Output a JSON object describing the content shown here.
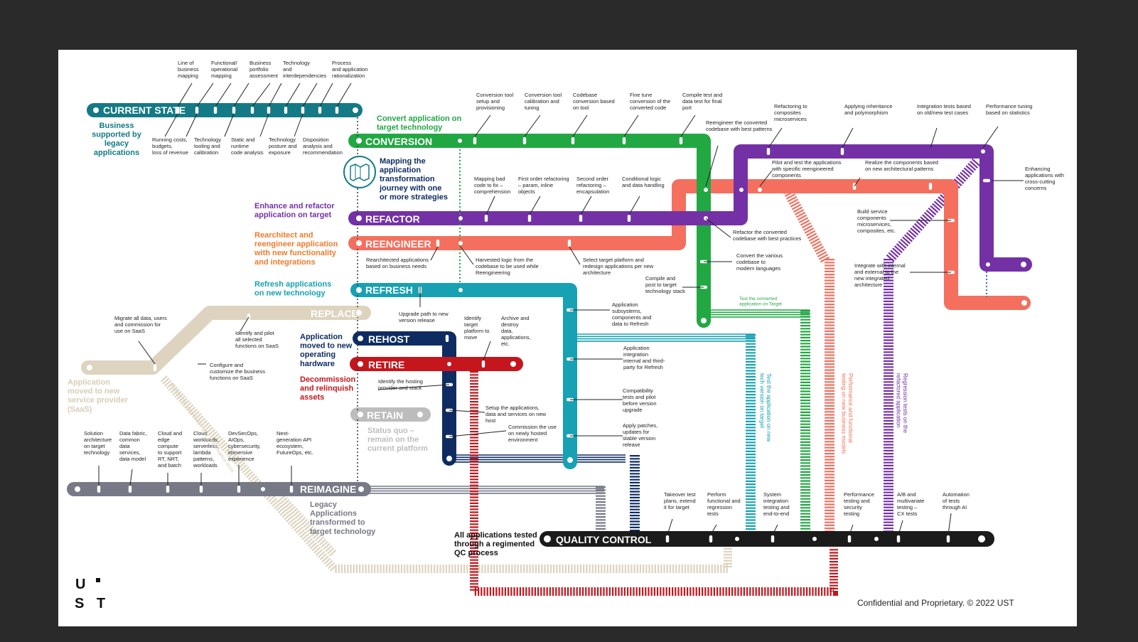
{
  "colors": {
    "page": "#2a2a2a",
    "slide": "#ffffff",
    "current": "#137a86",
    "conversion": "#22a843",
    "refactor": "#7431a6",
    "reengineer": "#f46f5e",
    "refresh": "#17a1b3",
    "replace": "#ddd3bf",
    "rehost": "#0f2c62",
    "retire": "#c4161c",
    "retain": "#bdbdbd",
    "reimagine": "#777a86",
    "qc": "#1b1b1b"
  },
  "lines": {
    "current": "CURRENT STATE",
    "conversion": "CONVERSION",
    "refactor": "REFACTOR",
    "reengineer": "REENGINEER",
    "refresh": "REFRESH",
    "replace": "REPLACE",
    "rehost": "REHOST",
    "retire": "RETIRE",
    "retain": "RETAIN",
    "reimagine": "REIMAGINE",
    "qc": "QUALITY CONTROL"
  },
  "headings": {
    "business": [
      "Business",
      "supported by",
      "legacy",
      "applications"
    ],
    "mapping": [
      "Mapping the",
      "application",
      "transformation",
      "journey with one",
      "or more strategies"
    ],
    "convert": [
      "Convert application on",
      "target technology"
    ],
    "enhance": [
      "Enhance  and refactor",
      "application on target"
    ],
    "rearchitect": [
      "Rearchitect and",
      "reengineer application",
      "with new functionality",
      "and integrations"
    ],
    "refresh": [
      "Refresh applications",
      "on new technology"
    ],
    "saas": [
      "Application",
      "moved to new",
      "service provider",
      "(SaaS)"
    ],
    "rehost": [
      "Application",
      "moved to new",
      "operating",
      "hardware"
    ],
    "retire": [
      "Decommission",
      "and relinquish",
      "assets"
    ],
    "retain": [
      "Status quo –",
      "remain on the",
      "current platform"
    ],
    "legacy": [
      "Legacy",
      "Applications",
      "transformed to",
      "target technology"
    ],
    "qc": [
      "All applications tested",
      "through a regimented",
      "QC process"
    ]
  },
  "current_top": [
    [
      "Line of",
      "business",
      "mapping"
    ],
    [
      "Functional/",
      "operational",
      "mapping"
    ],
    [
      "Business",
      "portfolio",
      "assessment"
    ],
    [
      "Technology",
      "and",
      "interdependencies"
    ],
    [
      "Process",
      "and application",
      "rationalization"
    ]
  ],
  "current_bottom": [
    [
      "Running costs,",
      "budgets,",
      "loss of revenue"
    ],
    [
      "Technology",
      "tooling and",
      "calibration"
    ],
    [
      "Static and",
      "runtime",
      "code analysis"
    ],
    [
      "Technology",
      "posture and",
      "exposure"
    ],
    [
      "Disposition",
      "analysis and",
      "recommendation"
    ]
  ],
  "conversion_top": [
    [
      "Conversion tool",
      "setup and",
      "provisioning"
    ],
    [
      "Conversion tool",
      "calibration and",
      "tuning"
    ],
    [
      "Codebase",
      "conversion based",
      "on tool"
    ],
    [
      "Fine tune",
      "conversion of the",
      "converted code"
    ],
    [
      "Compile test and",
      "data test for final",
      "port"
    ]
  ],
  "refactor_top": [
    [
      "Mapping bad",
      "code to fix –",
      "comprehension"
    ],
    [
      "First order refactoring",
      "– param, inline",
      "objects"
    ],
    [
      "Second order",
      "refactoring –",
      "encapsulation"
    ],
    [
      "Conditional logic",
      "and data handling"
    ]
  ],
  "purple_top": [
    [
      "Refactoring to",
      "composites",
      "microservices"
    ],
    [
      "Applying inheritance",
      "and polymorphism"
    ],
    [
      "Integration tests based",
      "on old/new test cases"
    ],
    [
      "Performance tuning",
      "based on statistics"
    ]
  ],
  "mid_labels": {
    "reengineer_best": [
      "Reengineer the converted",
      "codebase with best patterns"
    ],
    "pilot": [
      "Pilot and test the applications",
      "with specific reengineered",
      "components"
    ],
    "realize": [
      "Realize the components based",
      "on new architectural patterns"
    ],
    "enhancing": [
      "Enhancing",
      "applications with",
      "cross-cutting",
      "concerns"
    ],
    "build": [
      "Build service",
      "components",
      "microservices,",
      "composites, etc."
    ],
    "integrate": [
      "Integrate with internal",
      "and external to the",
      "new integrated",
      "architecture"
    ],
    "refactor_best": [
      "Refactor the converted",
      "codebase with best practices"
    ],
    "convert_lang": [
      "Convert the various",
      "codebase to",
      "modern languages"
    ],
    "compile": [
      "Compile and",
      "post to target",
      "technology stack"
    ],
    "test_target": [
      "Test the converted",
      "application on Target"
    ],
    "rearch_apps": [
      "Rearchitected applications",
      "based on business needs"
    ],
    "harvested": [
      "Harvested logic from the",
      "codebase to be used while",
      "Reengineering"
    ],
    "select": [
      "Select target platform and",
      "redesign applications per new",
      "architecture"
    ],
    "upgrade": [
      "Upgrade path to new",
      "version release"
    ],
    "identify_target": [
      "Identify",
      "target",
      "platform to",
      "move"
    ],
    "archive": [
      "Archive and",
      "destroy",
      "data,",
      "applications,",
      "etc."
    ],
    "app_subsys": [
      "Application",
      "subsystems,",
      "components and",
      "data to Refresh"
    ],
    "app_integ": [
      "Application",
      "integration",
      "internal and third-",
      "party for Refresh"
    ],
    "compat": [
      "Compatibility",
      "tests and pilot",
      "before version",
      "upgrade"
    ],
    "patches": [
      "Apply patches,",
      "updates for",
      "stable version",
      "release"
    ],
    "migrate": [
      "Migrate all data, users",
      "and commission for",
      "use on SaaS"
    ],
    "identify_pilot": [
      "Identify and pilot",
      "all selected",
      "functions on SaaS"
    ],
    "configure": [
      "Configure and",
      "customize the business",
      "functions on SaaS"
    ],
    "identify_host": [
      "Identify the hosting",
      "provider and stack"
    ],
    "setup": [
      "Setup the applications,",
      "data and services on new",
      "host"
    ],
    "commission": [
      "Commission the use",
      "on newly hosted",
      "environment"
    ]
  },
  "reimagine_top": [
    [
      "Solution",
      "architecture",
      "on target",
      "technology"
    ],
    [
      "Data fabric,",
      "common",
      "data",
      "services,",
      "data model"
    ],
    [
      "Cloud and",
      "edge",
      "compute",
      "to support",
      "RT, NRT,",
      "and batch"
    ],
    [
      "Cloud",
      "workloads,",
      "serverless,",
      "lambda",
      "patterns,",
      "workloads"
    ],
    [
      "DevSecOps,",
      "AIOps,",
      "cybersecurity,",
      "immersive",
      "experience"
    ],
    [
      "Next-",
      "generation API",
      "ecosystem,",
      "FutureOps, etc."
    ]
  ],
  "qc_top": [
    [
      "Takeover test",
      "plans, extend",
      "it for target"
    ],
    [
      "Perform",
      "functional and",
      "regression",
      "tests"
    ],
    [
      "System",
      "integration",
      "testing and",
      "end-to-end"
    ],
    [
      "Performance",
      "testing  and",
      "security",
      "testing"
    ],
    [
      "A/B and",
      "multivariate",
      "testing –",
      "CX tests"
    ],
    [
      "Automation",
      "of tests",
      "through AI"
    ]
  ],
  "vertical": {
    "functional": "Functional, regression and performance tests",
    "tech": [
      "Test the application on new",
      "tech version on target"
    ],
    "perf": [
      "Performance and functional",
      "testing on new business models"
    ],
    "regress": [
      "Regression tests on the",
      "refactored application"
    ]
  },
  "logo": [
    "U",
    "S T"
  ],
  "footer": "Confidential and Proprietary. © 2022 UST"
}
